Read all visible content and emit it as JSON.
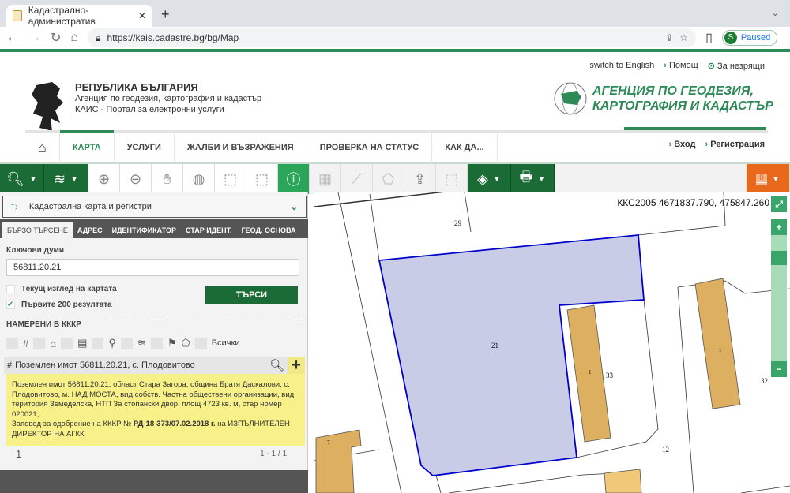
{
  "browser": {
    "tab_title": "Кадастрално-административ",
    "url": "https://kais.cadastre.bg/bg/Map",
    "profile_initial": "S",
    "profile_status": "Paused"
  },
  "header": {
    "links": [
      "switch to English",
      "Помощ",
      "За незрящи"
    ],
    "title": "РЕПУБЛИКА БЪЛГАРИЯ",
    "subtitle": "Агенция по геодезия, картография и кадастър",
    "portal": "КАИС - Портал за електронни услуги",
    "agency_line1": "АГЕНЦИЯ ПО ГЕОДЕЗИЯ,",
    "agency_line2": "КАРТОГРАФИЯ И КАДАСТЪР"
  },
  "nav": {
    "items": [
      "КАРТА",
      "УСЛУГИ",
      "ЖАЛБИ И ВЪЗРАЖЕНИЯ",
      "ПРОВЕРКА НА СТАТУС",
      "КАК ДА..."
    ],
    "active": "КАРТА",
    "login": "Вход",
    "register": "Регистрация"
  },
  "toolbar": {
    "badge": "0"
  },
  "panel": {
    "dropdown": "Кадастрална карта и регистри",
    "tabs": [
      "БЪРЗО ТЪРСЕНЕ",
      "АДРЕС",
      "ИДЕНТИФИКАТОР",
      "СТАР ИДЕНТ.",
      "ГЕОД. ОСНОВА"
    ],
    "keywords_label": "Ключови думи",
    "keywords_value": "56811.20.21",
    "current_view": "Текущ изглед на картата",
    "current_view_checked": false,
    "first200": "Първите 200 резултата",
    "first200_checked": true,
    "search_button": "ТЪРСИ",
    "found_title": "НАМЕРЕНИ В КККР",
    "all_label": "Всички",
    "result_title": "Поземлен имот 56811.20.21, с. Плодовитово",
    "result_text": "Поземлен имот 56811.20.21, област Стара Загора, община Братя Даскалови, с. Плодовитово, м. НАД МОСТА, вид собств. Частна обществени организации, вид територия Земеделска, НТП За стопански двор, площ 4723 кв. м, стар номер 020021,",
    "order_prefix": "Заповед за одобрение на КККР №",
    "order_number": "РД-18-373/07.02.2018 г.",
    "order_suffix": "на ИЗПЪЛНИТЕЛЕН ДИРЕКТОР НА АГКК",
    "page": "1",
    "count": "1 - 1 / 1"
  },
  "map": {
    "coords": "ККС2005 4671837.790, 475847.260",
    "labels": [
      "29",
      "21",
      "1",
      "33",
      "1",
      "32",
      "12",
      "7"
    ],
    "highlight_color": "#c9cce6",
    "outline_color": "#0000cc",
    "building_color": "#dcb060"
  }
}
